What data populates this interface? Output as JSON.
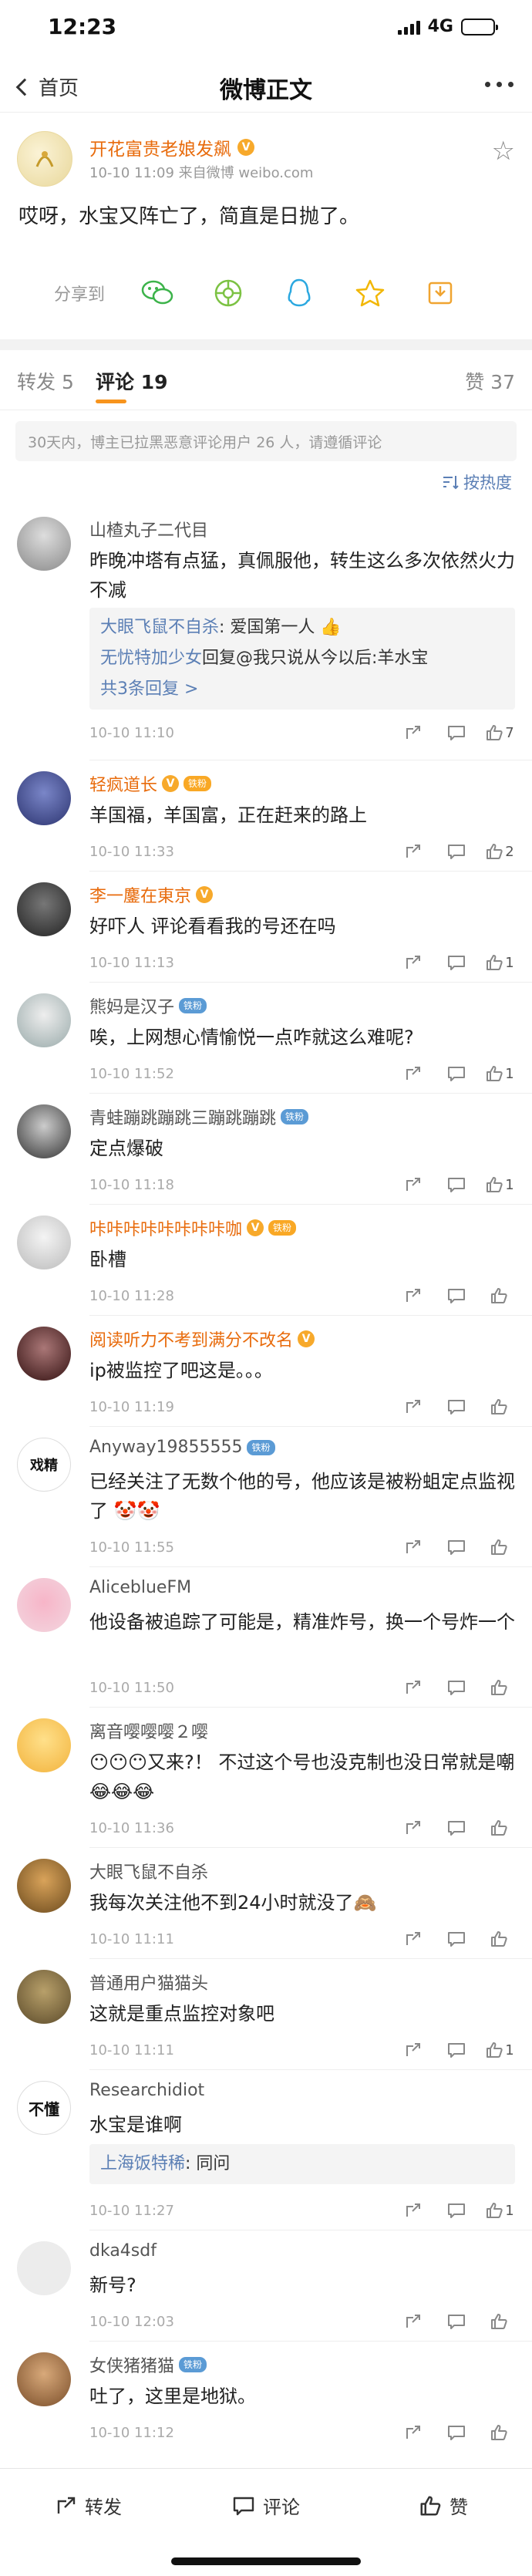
{
  "status_bar": {
    "time": "12:23",
    "network": "4G"
  },
  "nav": {
    "back_label": "首页",
    "title": "微博正文"
  },
  "post": {
    "author": "开花富贵老娘发飙",
    "meta": "10-10 11:09  来自微博 weibo.com",
    "text": "哎呀，水宝又阵亡了，简直是日抛了。",
    "share_label": "分享到",
    "share_targets": [
      "wechat-icon",
      "moments-icon",
      "qq-icon",
      "qzone-icon",
      "save-image-icon"
    ]
  },
  "tabs": {
    "repost": "转发 5",
    "comment": "评论 19",
    "like": "赞 37"
  },
  "notice": "30天内，博主已拉黑恶意评论用户 26 人，请遵循评论",
  "sort_label": "按热度",
  "comments": [
    {
      "name": "山楂丸子二代目",
      "text": "昨晚冲塔有点猛，真佩服他，转生这么多次依然火力不减",
      "time": "10-10 11:10",
      "likes": "7",
      "replies": [
        {
          "name": "大眼飞鼠不自杀",
          "text": ": 爱国第一人 👍"
        },
        {
          "name": "无忧特加少女",
          "text": "回复@我只说从今以后:羊水宝"
        }
      ],
      "more_replies": "共3条回复 >"
    },
    {
      "name": "轻疯道长",
      "text": "羊国福，羊国富，正在赶来的路上",
      "time": "10-10 11:33",
      "likes": "2"
    },
    {
      "name": "李一鏖在東京",
      "text": "好吓人 评论看看我的号还在吗",
      "time": "10-10 11:13",
      "likes": "1"
    },
    {
      "name": "熊妈是汉子",
      "text": "唉，上网想心情愉悦一点咋就这么难呢?",
      "time": "10-10 11:52",
      "likes": "1"
    },
    {
      "name": "青蛙蹦跳蹦跳三蹦跳蹦跳",
      "text": "定点爆破",
      "time": "10-10 11:18",
      "likes": "1"
    },
    {
      "name": "咔咔咔咔咔咔咔咔咖",
      "text": "卧槽",
      "time": "10-10 11:28",
      "likes": ""
    },
    {
      "name": "阅读听力不考到满分不改名",
      "text": "ip被监控了吧这是。。。",
      "time": "10-10 11:19",
      "likes": ""
    },
    {
      "name": "Anyway19855555",
      "text": "已经关注了无数个他的号，他应该是被粉蛆定点监视了 🤡🤡",
      "time": "10-10 11:55",
      "likes": ""
    },
    {
      "name": "AliceblueFM",
      "text": "他设备被追踪了可能是，精准炸号，换一个号炸一个",
      "time": "10-10 11:50",
      "likes": ""
    },
    {
      "name": "离音嘤嘤嘤２嘤",
      "text": "😶😶😶又来?！ 不过这个号也没克制也没日常就是嘲 😂😂😂",
      "time": "10-10 11:36",
      "likes": ""
    },
    {
      "name": "大眼飞鼠不自杀",
      "text": "我每次关注他不到24小时就没了🙈",
      "time": "10-10 11:11",
      "likes": ""
    },
    {
      "name": "普通用户猫猫头",
      "text": "这就是重点监控对象吧",
      "time": "10-10 11:11",
      "likes": "1"
    },
    {
      "name": "Researchidiot",
      "text": "水宝是谁啊",
      "time": "10-10 11:27",
      "likes": "1",
      "replies": [
        {
          "name": "上海饭特稀",
          "text": ": 同问"
        }
      ]
    },
    {
      "name": "dka4sdf",
      "text": "新号?",
      "time": "10-10 12:03",
      "likes": ""
    },
    {
      "name": "女侠猪猪猫",
      "text": "吐了，这里是地狱。",
      "time": "10-10 11:12",
      "likes": ""
    }
  ],
  "bottom_bar": {
    "repost": "转发",
    "comment": "评论",
    "like": "赞"
  },
  "colors": {
    "accent": "#f7941d",
    "vip_name": "#e86b0c",
    "link": "#5b7fb5"
  }
}
